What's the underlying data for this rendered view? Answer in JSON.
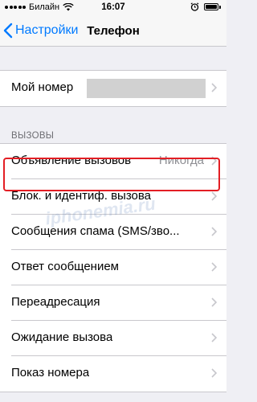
{
  "status_bar": {
    "carrier": "Билайн",
    "time": "16:07"
  },
  "nav": {
    "back_label": "Настройки",
    "title": "Телефон"
  },
  "my_number": {
    "label": "Мой номер"
  },
  "calls_section": {
    "header": "ВЫЗОВЫ",
    "items": [
      {
        "label": "Объявление вызовов",
        "value": "Никогда"
      },
      {
        "label": "Блок. и идентиф. вызова"
      },
      {
        "label": "Сообщения спама (SMS/зво..."
      },
      {
        "label": "Ответ сообщением"
      },
      {
        "label": "Переадресация"
      },
      {
        "label": "Ожидание вызова"
      },
      {
        "label": "Показ номера"
      }
    ]
  },
  "watermark": "iphonemia.ru",
  "colors": {
    "accent": "#007aff",
    "highlight": "#e31e24"
  }
}
